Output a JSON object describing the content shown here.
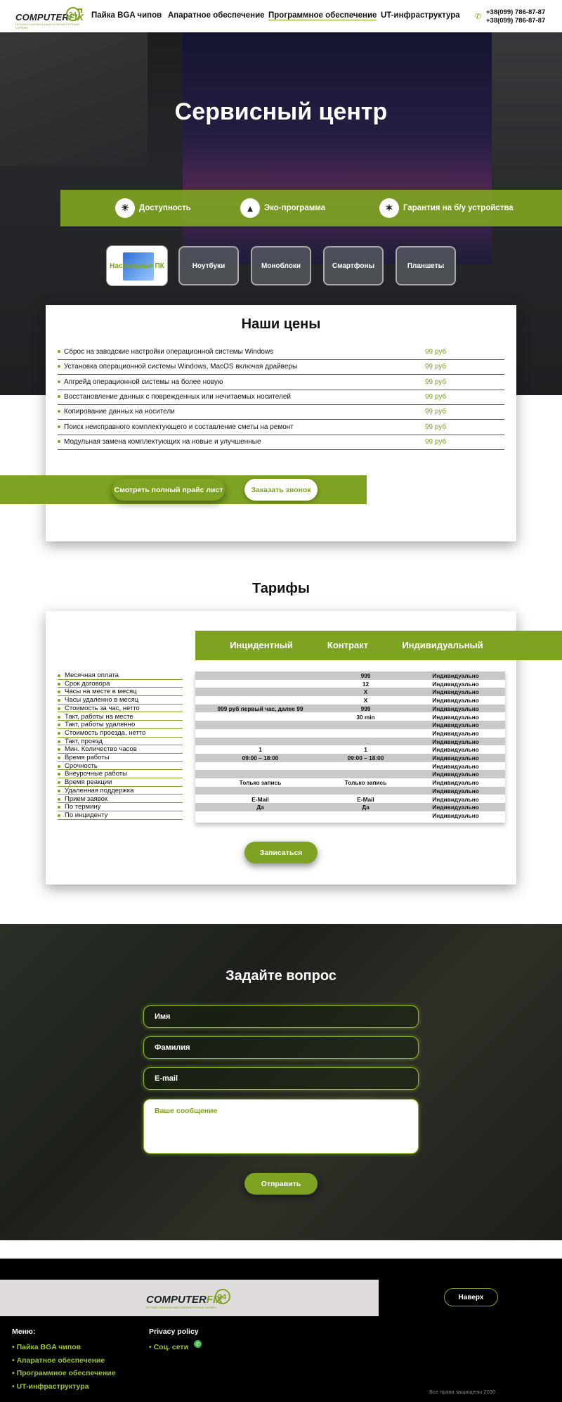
{
  "header": {
    "logo_text_a": "COMPUTER",
    "logo_text_b": "FIX",
    "logo_badge": "24",
    "logo_slogan": "ПРОФЕССИОНАЛЬНЫЙ КОМПЬЮТЕРНЫЙ СЕРВИС",
    "nav": [
      {
        "label": "Пайка BGA чипов"
      },
      {
        "label": "Апаратное обеспечение"
      },
      {
        "label": "Программное обеспечение",
        "active": true
      },
      {
        "label": "UT-инфраструктура"
      }
    ],
    "phones": [
      "+38(099) 786-87-87",
      "+38(099) 786-87-87"
    ]
  },
  "hero": {
    "title": "Сервисный центр",
    "features": [
      {
        "icon": "bulb-icon",
        "label": "Доступность"
      },
      {
        "icon": "recycle-icon",
        "label": "Эко-программа"
      },
      {
        "icon": "award-icon",
        "label": "Гарантия на б/у устройства"
      }
    ],
    "categories": [
      {
        "label": "Настольные ПК",
        "selected": true
      },
      {
        "label": "Ноутбуки"
      },
      {
        "label": "Моноблоки"
      },
      {
        "label": "Смартфоны"
      },
      {
        "label": "Планшеты"
      }
    ]
  },
  "prices": {
    "title": "Наши цены",
    "items": [
      {
        "name": "Сброс на заводские настройки операционной системы Windows",
        "price": "99  руб"
      },
      {
        "name": "Установка операционной системы Windows, MacOS включая драйверы",
        "price": "99  руб"
      },
      {
        "name": "Апгрейд операционной системы на более новую",
        "price": "99  руб"
      },
      {
        "name": "Восстановление данных с поврежденных или нечитаемых носителей",
        "price": "99  руб"
      },
      {
        "name": "Копирование данных на носители",
        "price": "99  руб"
      },
      {
        "name": "Поиск неисправного комплектующего и составление сметы на ремонт",
        "price": "99  руб"
      },
      {
        "name": "Модульная замена комплектующих на новые и улучшенные",
        "price": "99  руб"
      }
    ],
    "full_price_button": "Смотреть полный прайс лист",
    "callback_button": "Заказать звонок"
  },
  "tariffs": {
    "title": "Тарифы",
    "columns": [
      "Инцидентный",
      "Контракт",
      "Индивидуальный"
    ],
    "rows": [
      {
        "label": "Месячная оплата",
        "values": [
          "",
          "999",
          "Индивидуально"
        ]
      },
      {
        "label": "Срок договора",
        "values": [
          "",
          "12",
          "Индивидуально"
        ]
      },
      {
        "label": "Часы на месте в месяц",
        "values": [
          "",
          "X",
          "Индивидуально"
        ]
      },
      {
        "label": "Часы удаленно в месяц",
        "values": [
          "",
          "X",
          "Индивидуально"
        ]
      },
      {
        "label": "Стоимость за час, нетто",
        "values": [
          "999 руб первый час, далее 99",
          "999",
          "Индивидуально"
        ]
      },
      {
        "label": "Такт, работы на месте",
        "values": [
          "",
          "30 min",
          "Индивидуально"
        ]
      },
      {
        "label": "Такт, работы удаленно",
        "values": [
          "",
          "",
          "Индивидуально"
        ]
      },
      {
        "label": "Стоимость проезда, нетто",
        "values": [
          "",
          "",
          "Индивидуально"
        ]
      },
      {
        "label": "Такт, проезд",
        "values": [
          "",
          "",
          "Индивидуально"
        ]
      },
      {
        "label": "Мин. Количество часов",
        "values": [
          "1",
          "1",
          "Индивидуально"
        ]
      },
      {
        "label": "Время работы",
        "values": [
          "09:00 – 18:00",
          "09:00 – 18:00",
          "Индивидуально"
        ]
      },
      {
        "label": "Срочность",
        "values": [
          "",
          "",
          "Индивидуально"
        ]
      },
      {
        "label": "Внеурочные работы",
        "values": [
          "",
          "",
          "Индивидуально"
        ]
      },
      {
        "label": "Время реакции",
        "values": [
          "Только запись",
          "Только запись",
          "Индивидуально"
        ]
      },
      {
        "label": "Удаленная поддержка",
        "values": [
          "",
          "",
          "Индивидуально"
        ]
      },
      {
        "label": "Прием заявок",
        "values": [
          "E-Mail",
          "E-Mail",
          "Индивидуально"
        ]
      },
      {
        "label": "По термину",
        "values": [
          "Да",
          "Да",
          "Индивидуально"
        ]
      },
      {
        "label": "По инциденту",
        "values": [
          "",
          "",
          "Индивидуально"
        ]
      }
    ],
    "signup_button": "Записаться"
  },
  "form": {
    "title": "Задайте вопрос",
    "name_placeholder": "Имя",
    "surname_placeholder": "Фамилия",
    "email_placeholder": "E-mail",
    "message_placeholder": "Ваше сообщение",
    "submit_button": "Отправить"
  },
  "footer": {
    "up_button": "Наверх",
    "menu_title": "Меню:",
    "menu": [
      "Пайка BGA чипов",
      "Апаратное обеспечение",
      "Программное обеспечение",
      "UT-инфраструктура"
    ],
    "privacy_title": "Privacy policy",
    "social_label": "Соц. сети",
    "copyright": "Все права защищены 2020"
  },
  "colors": {
    "accent": "#7ea322",
    "dark": "#000000"
  }
}
